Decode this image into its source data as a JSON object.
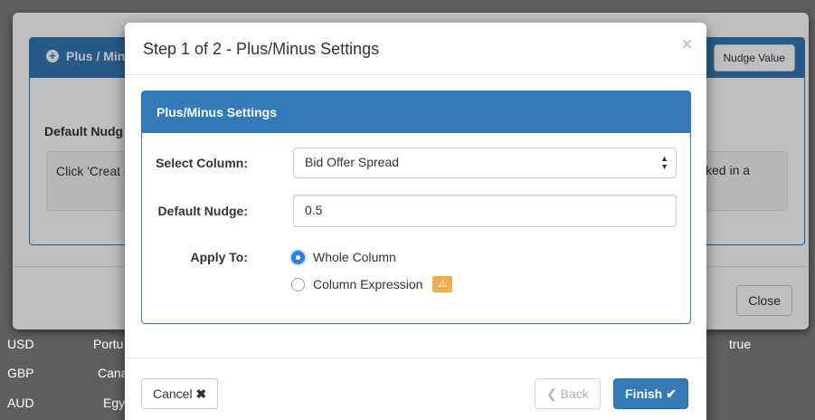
{
  "background_rows": [
    {
      "col1": "USD",
      "col2": "Portu",
      "col3": "true"
    },
    {
      "col1": "GBP",
      "col2": "Cana",
      "col3": ""
    },
    {
      "col1": "AUD",
      "col2": "Egy",
      "col3": ""
    }
  ],
  "underlying_modal": {
    "panel_title": "Plus / Min",
    "create_button": "Nudge Value",
    "default_label": "Default Nudg",
    "info_left": "Click 'Creat cell.",
    "info_right": "ked in a",
    "close_button": "Close"
  },
  "modal": {
    "title": "Step 1 of 2 - Plus/Minus Settings",
    "close_symbol": "×",
    "panel_heading": "Plus/Minus Settings",
    "select_column_label": "Select Column:",
    "select_column_value": "Bid Offer Spread",
    "default_nudge_label": "Default Nudge:",
    "default_nudge_value": "0.5",
    "apply_to_label": "Apply To:",
    "apply_options": [
      {
        "label": "Whole Column",
        "checked": true
      },
      {
        "label": "Column Expression",
        "checked": false
      }
    ],
    "footer": {
      "cancel_label": "Cancel",
      "back_label": "Back",
      "finish_label": "Finish"
    }
  },
  "colors": {
    "primary": "#337ab7",
    "warning": "#f0ad4e",
    "radio_checked": "#2e7fdb"
  }
}
